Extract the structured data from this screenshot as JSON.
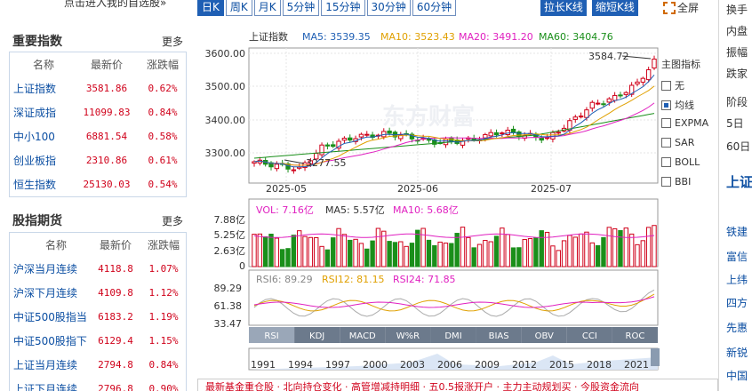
{
  "left": {
    "top_link": "点击进入我的自选股»",
    "indices": {
      "title": "重要指数",
      "more": "更多",
      "headers": [
        "名称",
        "最新价",
        "涨跌幅"
      ],
      "rows": [
        {
          "name": "上证指数",
          "price": "3581.86",
          "change": "0.62%"
        },
        {
          "name": "深证成指",
          "price": "11099.83",
          "change": "0.84%"
        },
        {
          "name": "中小100",
          "price": "6881.54",
          "change": "0.58%"
        },
        {
          "name": "创业板指",
          "price": "2310.86",
          "change": "0.61%"
        },
        {
          "name": "恒生指数",
          "price": "25130.03",
          "change": "0.54%"
        }
      ]
    },
    "futures": {
      "title": "股指期货",
      "more": "更多",
      "headers": [
        "名称",
        "最新价",
        "涨跌幅"
      ],
      "rows": [
        {
          "name": "沪深当月连续",
          "price": "4118.8",
          "change": "1.07%"
        },
        {
          "name": "沪深下月连续",
          "price": "4109.8",
          "change": "1.12%"
        },
        {
          "name": "中证500股指当…",
          "price": "6183.2",
          "change": "1.19%"
        },
        {
          "name": "中证500股指下…",
          "price": "6129.4",
          "change": "1.15%"
        },
        {
          "name": "上证当月连续",
          "price": "2794.8",
          "change": "0.84%"
        },
        {
          "name": "上证下月连续",
          "price": "2796.8",
          "change": "0.90%"
        }
      ]
    }
  },
  "tabs": [
    "日K",
    "周K",
    "月K",
    "5分钟",
    "15分钟",
    "30分钟",
    "60分钟"
  ],
  "buttons": {
    "stretch": "拉长K线",
    "shrink": "缩短K线",
    "fullscreen": "全屏"
  },
  "chart": {
    "title": "上证指数",
    "ma": {
      "ma5": "MA5: 3539.35",
      "ma10": "MA10: 3523.43",
      "ma20": "MA20: 3491.20",
      "ma60": "MA60: 3404.76"
    },
    "y_ticks": [
      "3600.00",
      "3500.00",
      "3400.00",
      "3300.00"
    ],
    "x_ticks": [
      "2025-05",
      "2025-06",
      "2025-07"
    ],
    "high_label": "3584.72",
    "low_label": "3277.55",
    "watermark": "东方财富",
    "vol": {
      "vol": "VOL: 7.16亿",
      "ma5": "MA5: 5.57亿",
      "ma10": "MA10: 5.68亿",
      "ticks": [
        "7.88亿",
        "5.25亿",
        "2.63亿",
        "0"
      ]
    },
    "rsi": {
      "rsi6": "RSI6: 89.29",
      "rsi12": "RSI12: 81.15",
      "rsi24": "RSI24: 71.85",
      "ticks": [
        "89.29",
        "61.38",
        "33.47"
      ]
    },
    "indicator_tabs": [
      "RSI",
      "KDJ",
      "MACD",
      "W%R",
      "DMI",
      "BIAS",
      "OBV",
      "CCI",
      "ROC"
    ],
    "timeline_years": [
      "1991",
      "1994",
      "1997",
      "2000",
      "2003",
      "2006",
      "2009",
      "2012",
      "2015",
      "2018",
      "2021"
    ]
  },
  "indicators": {
    "title": "主图指标",
    "items": [
      {
        "label": "无",
        "checked": false
      },
      {
        "label": "均线",
        "checked": true
      },
      {
        "label": "EXPMA",
        "checked": false
      },
      {
        "label": "SAR",
        "checked": false
      },
      {
        "label": "BOLL",
        "checked": false
      },
      {
        "label": "BBI",
        "checked": false
      }
    ]
  },
  "right": {
    "items": [
      "换手",
      "内盘",
      "振幅",
      "跌家",
      "阶段",
      "5日",
      "60日"
    ],
    "section_title": "上证",
    "links": [
      "铁建",
      "富信",
      "上纬",
      "四方",
      "先惠",
      "新锐",
      "中国"
    ]
  },
  "bottom_ticker": "最新基金重仓股 · 北向持仓变化 · 高管增减持明细 · 五0.5报涨开户 · 主力主动规划买 · 今股资金流向",
  "colors": {
    "up": "#d0021b",
    "down": "#1a8f1a",
    "ma5": "#1f5fb4",
    "ma10": "#e0a000",
    "ma20": "#e020c0",
    "ma60": "#1a8f1a",
    "accent": "#1f5fb4"
  }
}
